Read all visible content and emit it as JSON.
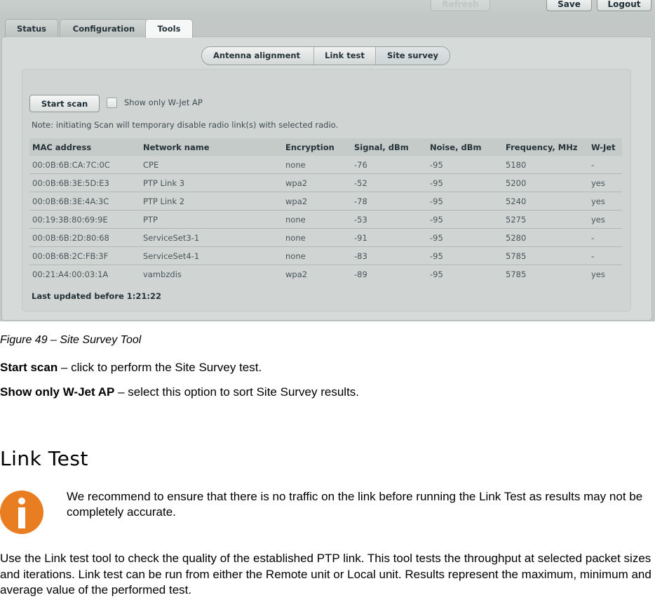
{
  "figure": {
    "top_buttons": {
      "refresh": "Refresh",
      "save": "Save",
      "logout": "Logout"
    },
    "tabs": [
      {
        "label": "Status",
        "active": false
      },
      {
        "label": "Configuration",
        "active": false
      },
      {
        "label": "Tools",
        "active": true
      }
    ],
    "subtabs": [
      {
        "label": "Antenna alignment",
        "active": false
      },
      {
        "label": "Link test",
        "active": false
      },
      {
        "label": "Site survey",
        "active": true
      }
    ],
    "start_scan_label": "Start scan",
    "show_only_wjet": {
      "label": "Show only W-Jet AP",
      "checked": false
    },
    "note": "Note: initiating Scan will temporary disable radio link(s) with selected radio.",
    "table": {
      "headers": [
        "MAC address",
        "Network name",
        "Encryption",
        "Signal, dBm",
        "Noise, dBm",
        "Frequency, MHz",
        "W-Jet"
      ],
      "rows": [
        [
          "00:0B:6B:CA:7C:0C",
          "CPE",
          "none",
          "-76",
          "-95",
          "5180",
          "-"
        ],
        [
          "00:0B:6B:3E:5D:E3",
          "PTP Link 3",
          "wpa2",
          "-52",
          "-95",
          "5200",
          "yes"
        ],
        [
          "00:0B:6B:3E:4A:3C",
          "PTP Link 2",
          "wpa2",
          "-78",
          "-95",
          "5240",
          "yes"
        ],
        [
          "00:19:3B:80:69:9E",
          "PTP",
          "none",
          "-53",
          "-95",
          "5275",
          "yes"
        ],
        [
          "00:0B:6B:2D:80:68",
          "ServiceSet3-1",
          "none",
          "-91",
          "-95",
          "5280",
          "-"
        ],
        [
          "00:0B:6B:2C:FB:3F",
          "ServiceSet4-1",
          "none",
          "-83",
          "-95",
          "5785",
          "-"
        ],
        [
          "00:21:A4:00:03:1A",
          "vambzdis",
          "wpa2",
          "-89",
          "-95",
          "5785",
          "yes"
        ]
      ]
    },
    "last_updated": "Last updated before 1:21:22"
  },
  "document": {
    "caption": "Figure 49 – Site Survey Tool",
    "items": [
      {
        "term": "Start scan",
        "desc": " – click to perform the Site Survey test."
      },
      {
        "term": "Show only W-Jet AP",
        "desc": " – select this option to sort Site Survey results."
      }
    ],
    "heading": "Link Test",
    "info_icon": "info-icon",
    "info_note": "We recommend to ensure that there is no traffic on the link before running the Link Test as results may not be completely accurate.",
    "body": "Use the Link test tool to check the quality of the established PTP link. This tool tests the throughput at selected packet sizes and iterations. Link test can be run from either the Remote unit or Local unit. Results represent the maximum, minimum and average value of the performed test.",
    "colors": {
      "info_icon": "#e87d21"
    }
  }
}
